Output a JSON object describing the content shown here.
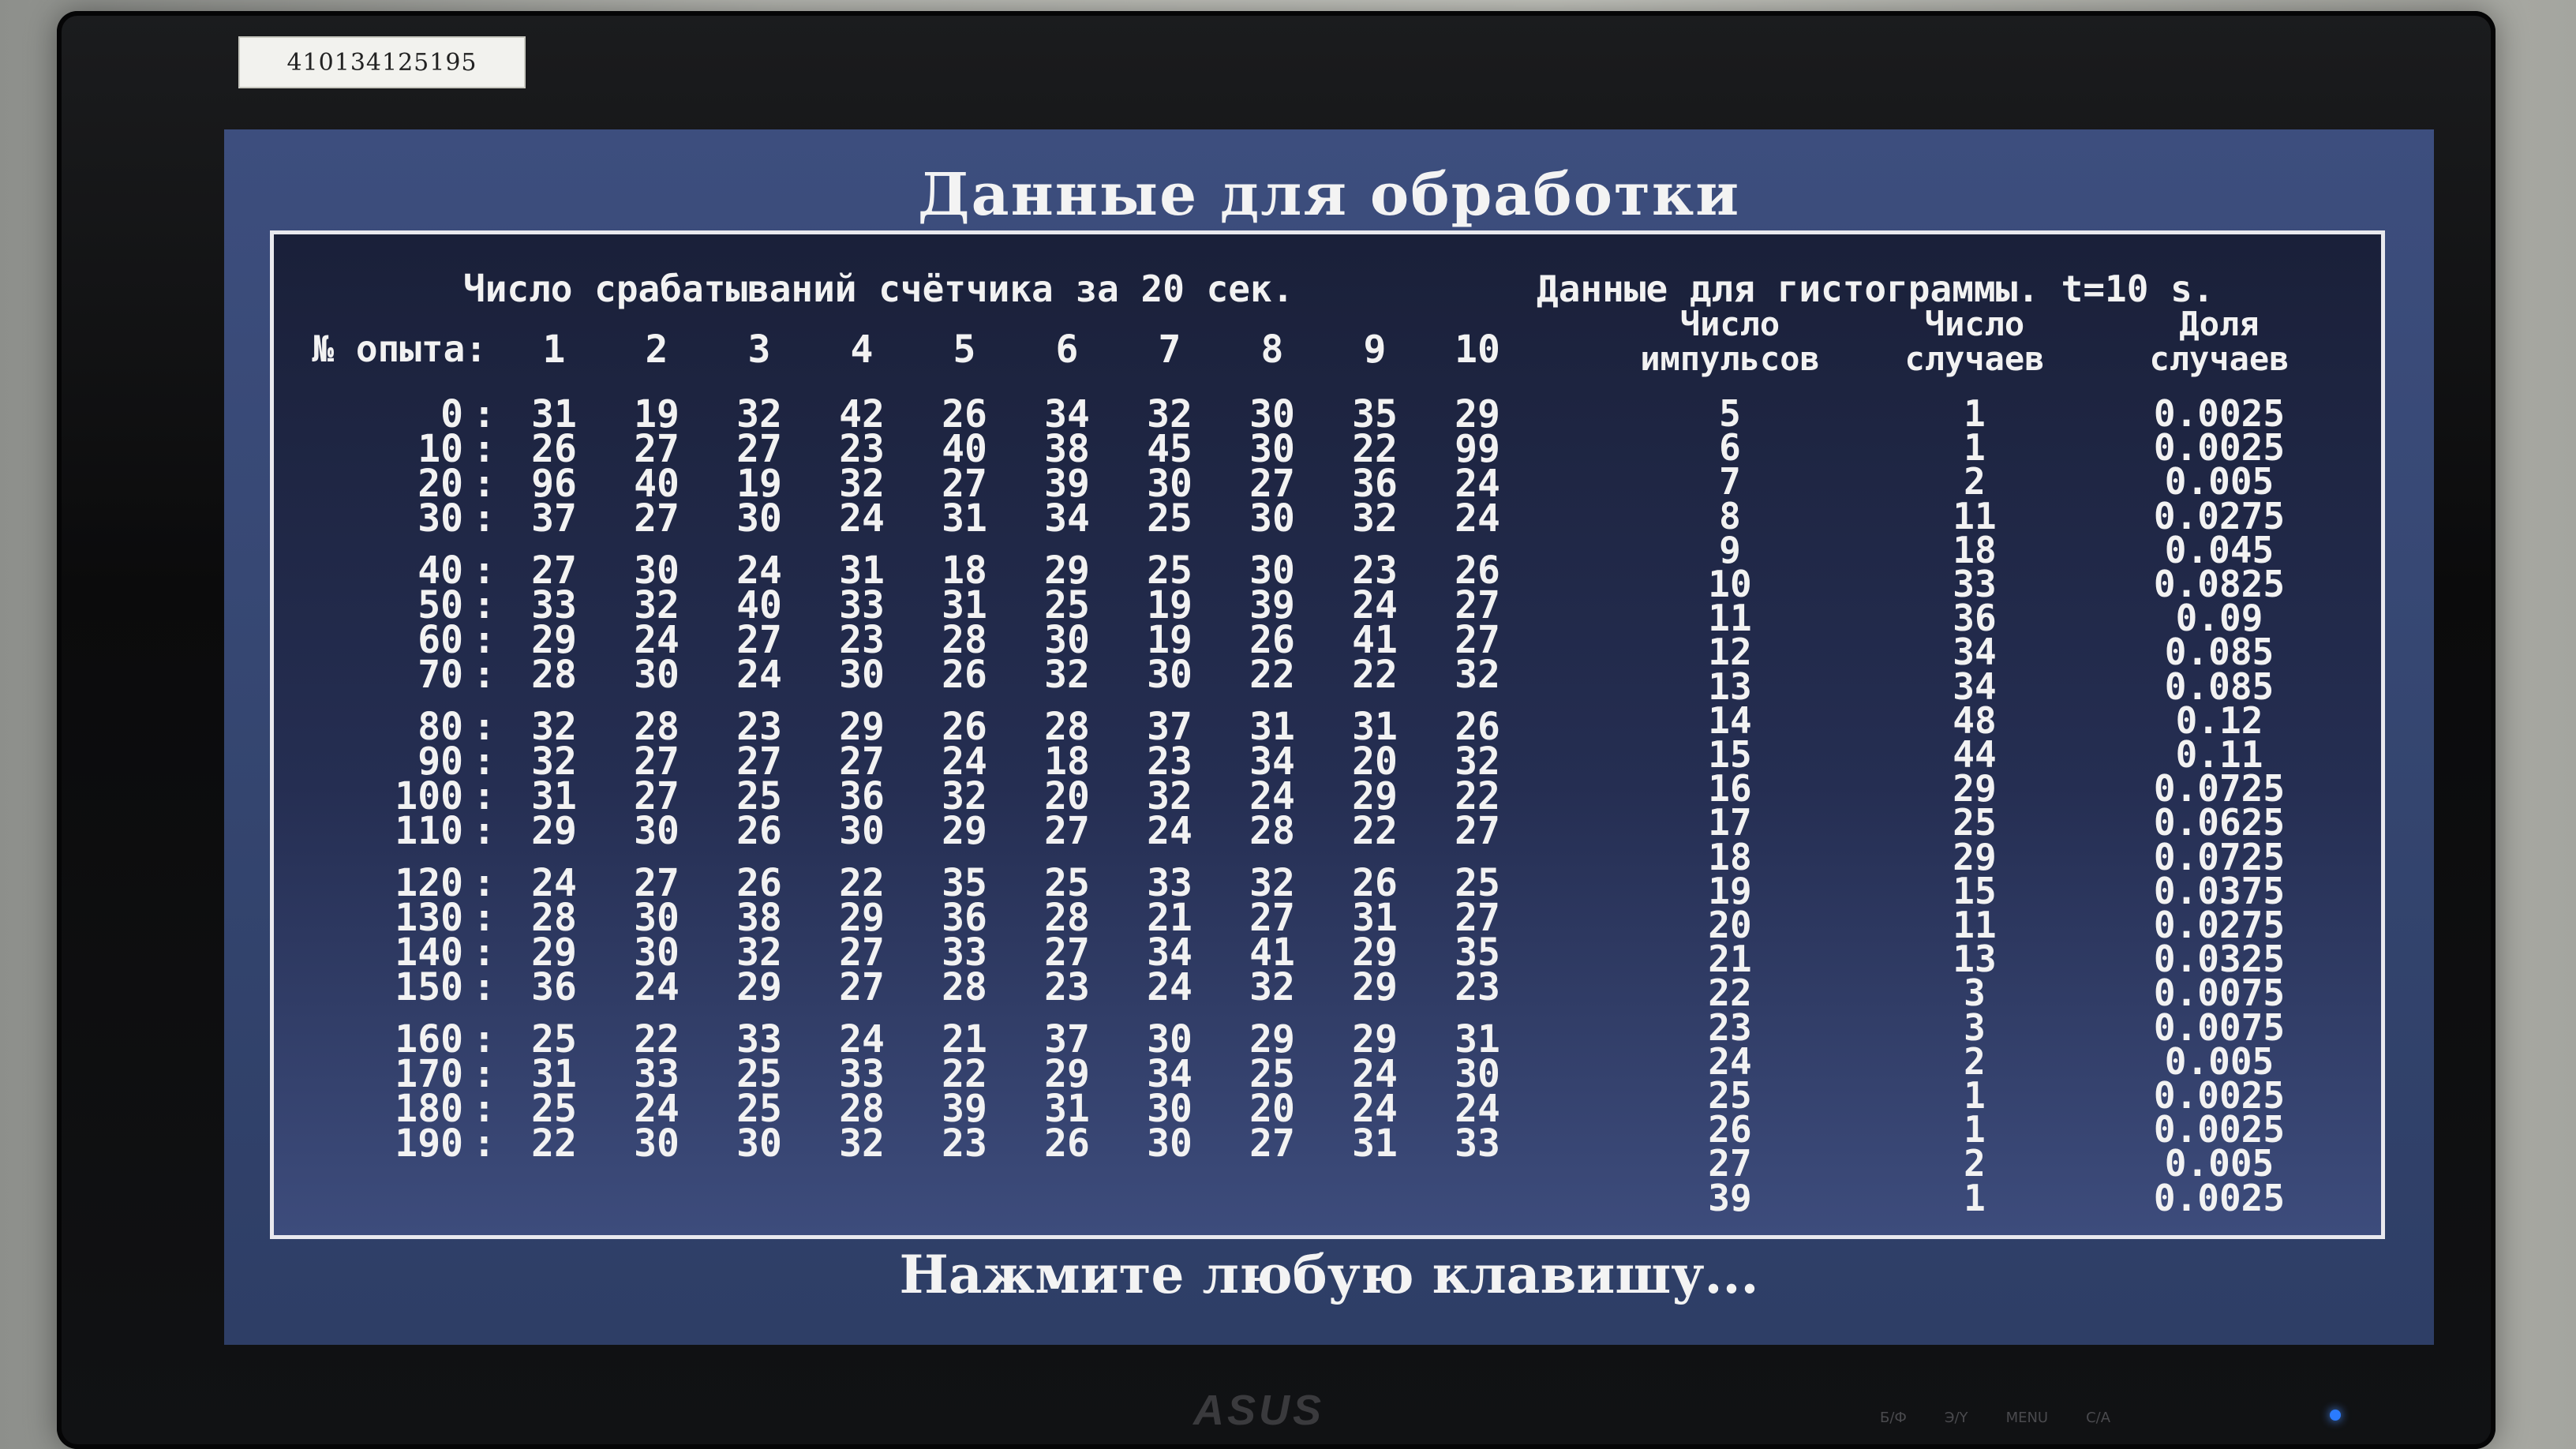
{
  "sticker": {
    "text": "410134125195"
  },
  "screen": {
    "title": "Данные для обработки",
    "prompt": "Нажмите любую клавишу..."
  },
  "counts_table": {
    "heading": "Число срабатываний счётчика за 20 сек.",
    "row_label": "№ опыта:",
    "trial_headers": [
      "1",
      "2",
      "3",
      "4",
      "5",
      "6",
      "7",
      "8",
      "9",
      "10"
    ],
    "rows": [
      {
        "start": "0",
        "values": [
          "31",
          "19",
          "32",
          "42",
          "26",
          "34",
          "32",
          "30",
          "35",
          "29"
        ]
      },
      {
        "start": "10",
        "values": [
          "26",
          "27",
          "27",
          "23",
          "40",
          "38",
          "45",
          "30",
          "22",
          "99"
        ]
      },
      {
        "start": "20",
        "values": [
          "96",
          "40",
          "19",
          "32",
          "27",
          "39",
          "30",
          "27",
          "36",
          "24"
        ]
      },
      {
        "start": "30",
        "values": [
          "37",
          "27",
          "30",
          "24",
          "31",
          "34",
          "25",
          "30",
          "32",
          "24"
        ]
      },
      {
        "start": "40",
        "values": [
          "27",
          "30",
          "24",
          "31",
          "18",
          "29",
          "25",
          "30",
          "23",
          "26"
        ]
      },
      {
        "start": "50",
        "values": [
          "33",
          "32",
          "40",
          "33",
          "31",
          "25",
          "19",
          "39",
          "24",
          "27"
        ]
      },
      {
        "start": "60",
        "values": [
          "29",
          "24",
          "27",
          "23",
          "28",
          "30",
          "19",
          "26",
          "41",
          "27"
        ]
      },
      {
        "start": "70",
        "values": [
          "28",
          "30",
          "24",
          "30",
          "26",
          "32",
          "30",
          "22",
          "22",
          "32"
        ]
      },
      {
        "start": "80",
        "values": [
          "32",
          "28",
          "23",
          "29",
          "26",
          "28",
          "37",
          "31",
          "31",
          "26"
        ]
      },
      {
        "start": "90",
        "values": [
          "32",
          "27",
          "27",
          "27",
          "24",
          "18",
          "23",
          "34",
          "20",
          "32"
        ]
      },
      {
        "start": "100",
        "values": [
          "31",
          "27",
          "25",
          "36",
          "32",
          "20",
          "32",
          "24",
          "29",
          "22"
        ]
      },
      {
        "start": "110",
        "values": [
          "29",
          "30",
          "26",
          "30",
          "29",
          "27",
          "24",
          "28",
          "22",
          "27"
        ]
      },
      {
        "start": "120",
        "values": [
          "24",
          "27",
          "26",
          "22",
          "35",
          "25",
          "33",
          "32",
          "26",
          "25"
        ]
      },
      {
        "start": "130",
        "values": [
          "28",
          "30",
          "38",
          "29",
          "36",
          "28",
          "21",
          "27",
          "31",
          "27"
        ]
      },
      {
        "start": "140",
        "values": [
          "29",
          "30",
          "32",
          "27",
          "33",
          "27",
          "34",
          "41",
          "29",
          "35"
        ]
      },
      {
        "start": "150",
        "values": [
          "36",
          "24",
          "29",
          "27",
          "28",
          "23",
          "24",
          "32",
          "29",
          "23"
        ]
      },
      {
        "start": "160",
        "values": [
          "25",
          "22",
          "33",
          "24",
          "21",
          "37",
          "30",
          "29",
          "29",
          "31"
        ]
      },
      {
        "start": "170",
        "values": [
          "31",
          "33",
          "25",
          "33",
          "22",
          "29",
          "34",
          "25",
          "24",
          "30"
        ]
      },
      {
        "start": "180",
        "values": [
          "25",
          "24",
          "25",
          "28",
          "39",
          "31",
          "30",
          "20",
          "24",
          "24"
        ]
      },
      {
        "start": "190",
        "values": [
          "22",
          "30",
          "30",
          "32",
          "23",
          "26",
          "30",
          "27",
          "31",
          "33"
        ]
      }
    ]
  },
  "histogram": {
    "heading": "Данные для гистограммы. t=10 s.",
    "headers": [
      {
        "line1": "Число",
        "line2": "импульсов"
      },
      {
        "line1": "Число",
        "line2": "случаев"
      },
      {
        "line1": "Доля",
        "line2": "случаев"
      }
    ],
    "rows": [
      {
        "pulses": "5",
        "cases": "1",
        "share": "0.0025"
      },
      {
        "pulses": "6",
        "cases": "1",
        "share": "0.0025"
      },
      {
        "pulses": "7",
        "cases": "2",
        "share": "0.005"
      },
      {
        "pulses": "8",
        "cases": "11",
        "share": "0.0275"
      },
      {
        "pulses": "9",
        "cases": "18",
        "share": "0.045"
      },
      {
        "pulses": "10",
        "cases": "33",
        "share": "0.0825"
      },
      {
        "pulses": "11",
        "cases": "36",
        "share": "0.09"
      },
      {
        "pulses": "12",
        "cases": "34",
        "share": "0.085"
      },
      {
        "pulses": "13",
        "cases": "34",
        "share": "0.085"
      },
      {
        "pulses": "14",
        "cases": "48",
        "share": "0.12"
      },
      {
        "pulses": "15",
        "cases": "44",
        "share": "0.11"
      },
      {
        "pulses": "16",
        "cases": "29",
        "share": "0.0725"
      },
      {
        "pulses": "17",
        "cases": "25",
        "share": "0.0625"
      },
      {
        "pulses": "18",
        "cases": "29",
        "share": "0.0725"
      },
      {
        "pulses": "19",
        "cases": "15",
        "share": "0.0375"
      },
      {
        "pulses": "20",
        "cases": "11",
        "share": "0.0275"
      },
      {
        "pulses": "21",
        "cases": "13",
        "share": "0.0325"
      },
      {
        "pulses": "22",
        "cases": "3",
        "share": "0.0075"
      },
      {
        "pulses": "23",
        "cases": "3",
        "share": "0.0075"
      },
      {
        "pulses": "24",
        "cases": "2",
        "share": "0.005"
      },
      {
        "pulses": "25",
        "cases": "1",
        "share": "0.0025"
      },
      {
        "pulses": "26",
        "cases": "1",
        "share": "0.0025"
      },
      {
        "pulses": "27",
        "cases": "2",
        "share": "0.005"
      },
      {
        "pulses": "39",
        "cases": "1",
        "share": "0.0025"
      }
    ]
  },
  "monitor": {
    "brand": "ASUS",
    "button_labels": [
      "Б/Ф",
      "Э/Y",
      "MENU",
      "С/А"
    ]
  },
  "colors": {
    "screen_bg": "#34456f",
    "panel_bg": "#1f2744",
    "text": "#f2f2f2",
    "power_led": "#2a7bff"
  }
}
